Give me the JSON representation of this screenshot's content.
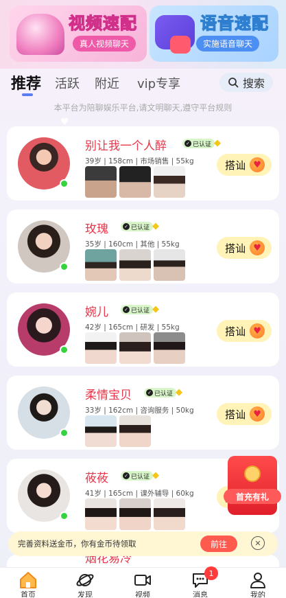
{
  "promos": [
    {
      "title": "视频速配",
      "subtitle": "真人视频聊天",
      "icon": "heart-box-icon"
    },
    {
      "title": "语音速配",
      "subtitle": "实施语音聊天",
      "icon": "voice-chat-icon"
    }
  ],
  "tabs": [
    {
      "label": "推荐",
      "active": true
    },
    {
      "label": "活跃",
      "active": false
    },
    {
      "label": "附近",
      "active": false
    },
    {
      "label": "vip专享",
      "active": false
    }
  ],
  "search": {
    "label": "搜索",
    "icon": "search-icon"
  },
  "notice": "本平台为陪聊娱乐平台,请文明聊天,遵守平台规则",
  "verified_label": "已认证",
  "chat_label": "搭讪",
  "users": [
    {
      "name": "别让我一个人醉",
      "info": "39岁 | 158cm | 市场销售 | 55kg",
      "photos": 3,
      "online": true
    },
    {
      "name": "玫瑰",
      "info": "35岁 | 160cm | 其他 | 55kg",
      "photos": 3,
      "online": true
    },
    {
      "name": "婉儿",
      "info": "42岁 | 165cm | 研发 | 55kg",
      "photos": 3,
      "online": true
    },
    {
      "name": "柔情宝贝",
      "info": "33岁 | 162cm | 咨询服务 | 50kg",
      "photos": 2,
      "online": true
    },
    {
      "name": "莜莜",
      "info": "41岁 | 165cm | 课外辅导 | 60kg",
      "photos": 3,
      "online": true
    }
  ],
  "next_user_peek": "烟花易冷",
  "red_packet": {
    "label": "首充有礼"
  },
  "gold_bar": {
    "text": "完善资料送金币，你有金币待领取",
    "button": "前往"
  },
  "bottom_nav": [
    {
      "label": "首页",
      "icon": "home-icon",
      "active": true
    },
    {
      "label": "发现",
      "icon": "planet-icon",
      "active": false
    },
    {
      "label": "视频",
      "icon": "video-icon",
      "active": false
    },
    {
      "label": "消息",
      "icon": "message-icon",
      "active": false,
      "badge": "1"
    },
    {
      "label": "我的",
      "icon": "profile-icon",
      "active": false
    }
  ],
  "colors": {
    "accent": "#e8364a",
    "online": "#35d43f",
    "chat_button": "#fff3b8",
    "tab_indicator": "#5b7bf0"
  }
}
